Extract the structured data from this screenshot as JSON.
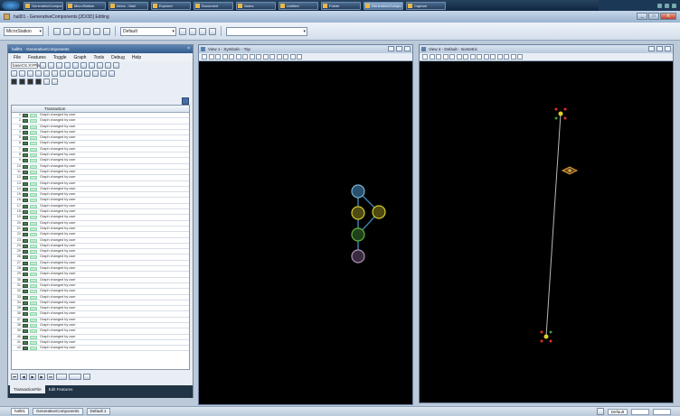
{
  "taskbar": {
    "items": [
      "GenerativeComponents",
      "MicroStation",
      "Inbox - Mail",
      "Explorer",
      "Document",
      "Notes",
      "Untitled",
      "Folder",
      "GenerativeCompo...",
      "Capture"
    ],
    "active_index": 8
  },
  "window": {
    "title": "hall01 - GenerativeComponents [2D/3D] Editing",
    "buttons": [
      "_",
      "□",
      "X"
    ]
  },
  "toolbar": {
    "workspace": "MicroStation",
    "level": "Default"
  },
  "transaction_panel": {
    "title": "hall01 - GenerativeComponents",
    "menu": [
      "File",
      "Features",
      "Toggle",
      "Graph",
      "Tools",
      "Debug",
      "Help"
    ],
    "plane_label": "baseCS.XYPlane",
    "column_header": "Transaction",
    "rows": [
      "Graph changed by user",
      "Graph changed by user",
      "Graph changed by user",
      "Graph changed by user",
      "Graph changed by user",
      "Graph changed by user",
      "Graph changed by user",
      "Graph changed by user",
      "Graph changed by user",
      "Graph changed by user",
      "Graph changed by user",
      "Graph changed by user",
      "Graph changed by user",
      "Graph changed by user",
      "Graph changed by user",
      "Graph changed by user",
      "Graph changed by user",
      "Graph changed by user",
      "Graph changed by user",
      "Graph changed by user",
      "Graph changed by user",
      "Graph changed by user",
      "Graph changed by user",
      "Graph changed by user",
      "Graph changed by user",
      "Graph changed by user",
      "Graph changed by user",
      "Graph changed by user",
      "Graph changed by user",
      "Graph changed by user",
      "Graph changed by user",
      "Graph changed by user",
      "Graph changed by user",
      "Graph changed by user",
      "Graph changed by user",
      "Graph changed by user",
      "Graph changed by user",
      "Graph changed by user",
      "Graph changed by user",
      "Graph changed by user",
      "Graph changed by user",
      "Graph changed by user"
    ],
    "tabs": [
      "TransactionFile",
      "Edit Features"
    ]
  },
  "view1": {
    "title": "View 1 - Symbolic - Top"
  },
  "view2": {
    "title": "View 2 - Default - Isometric"
  },
  "statusbar": {
    "tabs": [
      "hall01",
      "GenerativeComponents",
      "Default 1"
    ],
    "level": "Default"
  },
  "colors": {
    "canvas": "#000000",
    "node_yellow": "#c8c020",
    "node_green": "#50a040",
    "node_blue": "#4a7fa0",
    "point_red": "#e03020"
  }
}
